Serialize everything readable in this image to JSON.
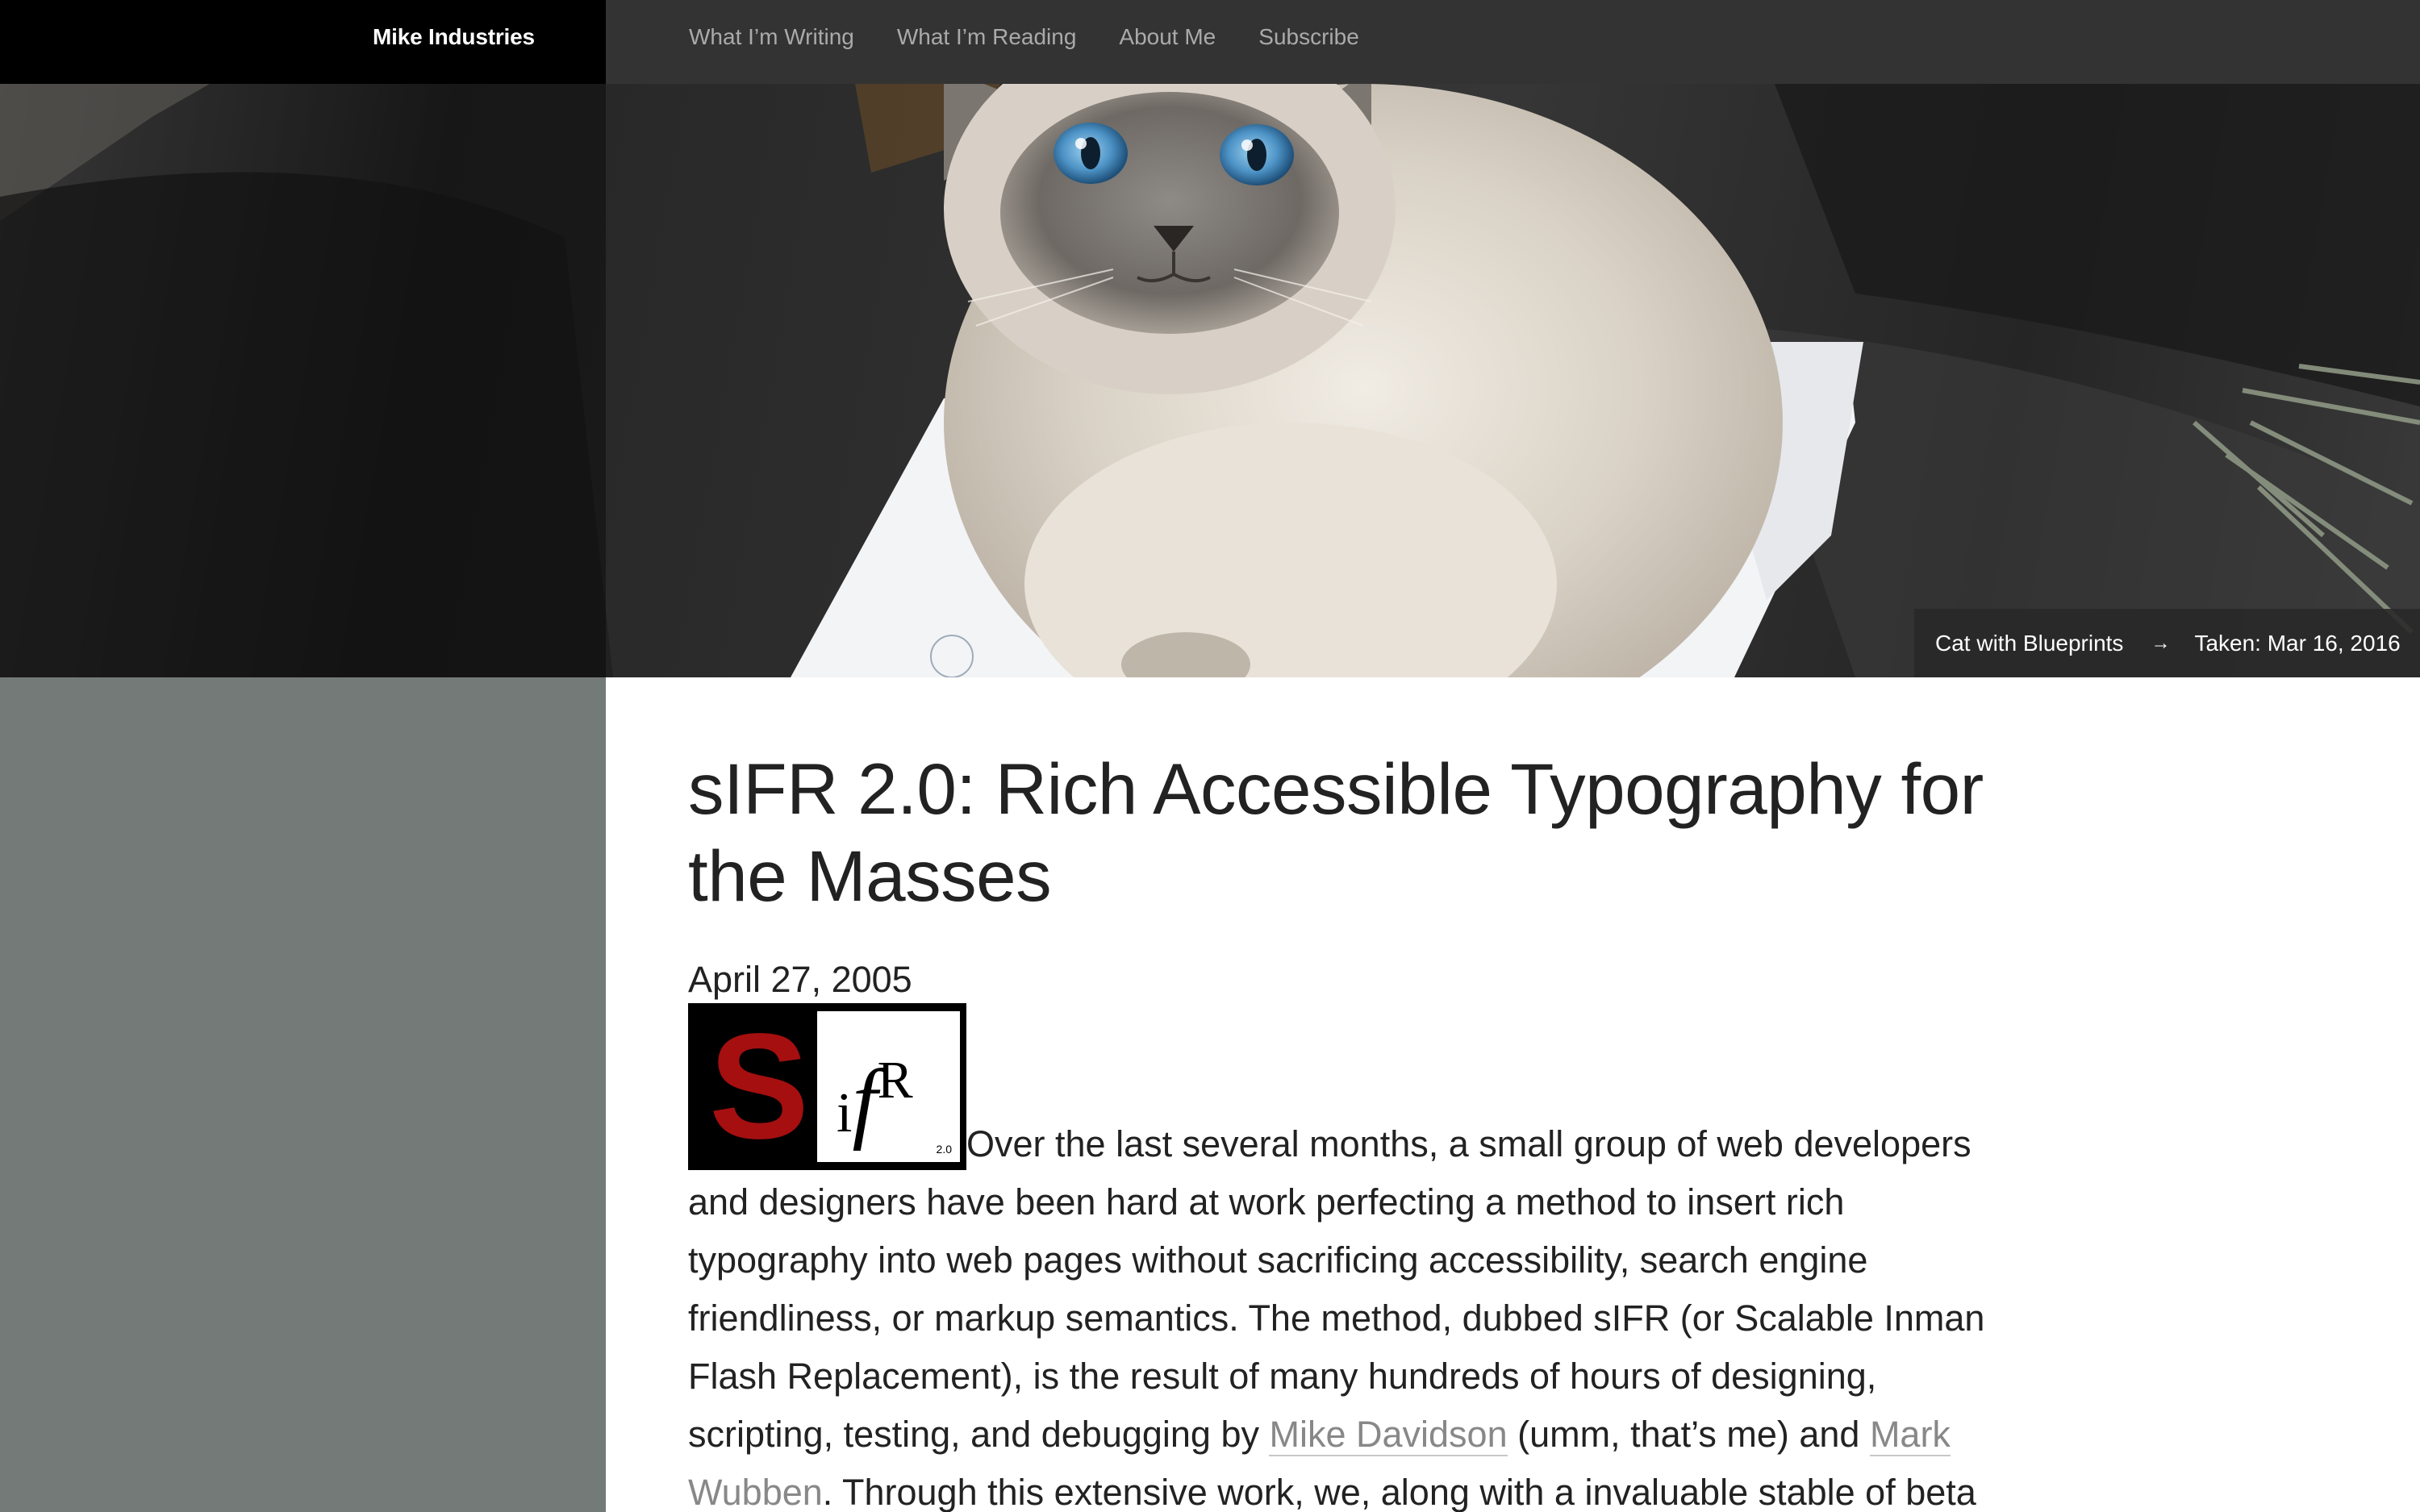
{
  "site": {
    "name": "Mike Industries"
  },
  "nav": {
    "items": [
      {
        "label": "What I’m Writing"
      },
      {
        "label": "What I’m Reading"
      },
      {
        "label": "About Me"
      },
      {
        "label": "Subscribe"
      }
    ]
  },
  "hero": {
    "caption_title": "Cat with Blueprints",
    "caption_arrow": "→",
    "caption_taken": "Taken: Mar 16, 2016"
  },
  "post": {
    "title": "sIFR 2.0: Rich Accessible Typography for the Masses",
    "date": "April 27, 2005",
    "logo": {
      "s": "S",
      "i": "i",
      "f": "f",
      "r": "R",
      "version": "2.0"
    },
    "lines": {
      "l1": "Over the last several months, a small group of web developers",
      "l2": "and designers have been hard at work perfecting a method to insert rich",
      "l3": "typography into web pages without sacrificing accessibility, search engine",
      "l4": "friendliness, or markup semantics. The method, dubbed sIFR (or Scalable Inman",
      "l5": "Flash Replacement), is the result of many hundreds of hours of designing,",
      "l6_a": "scripting, testing, and debugging by ",
      "l6_link1": "Mike Davidson",
      "l6_b": " (umm, that’s me) and ",
      "l6_link2_a": "Mark",
      "l7_link2_b": "Wubben",
      "l7_b": ". Through this extensive work, we, along with a invaluable stable of beta"
    }
  },
  "colors": {
    "brand_bar": "#000000",
    "nav_bar": "#333333",
    "nav_text": "#aaaaaa",
    "side_panel": "#747a78",
    "link": "#888888",
    "logo_red": "#a50f10"
  }
}
